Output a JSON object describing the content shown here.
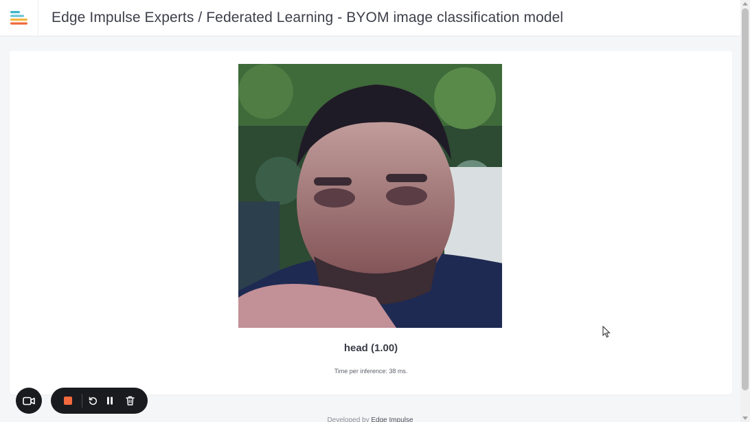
{
  "header": {
    "title": "Edge Impulse Experts / Federated Learning - BYOM image classification model",
    "logo_icon": "edge-impulse-logo-icon"
  },
  "main": {
    "classification_result": "head (1.00)",
    "inference_time": "Time per inference: 38 ms.",
    "image_description_icon": "camera-frame-image"
  },
  "footer": {
    "prefix": "Developed by ",
    "brand": "Edge Impulse"
  },
  "recorder": {
    "camera_icon": "video-camera-icon",
    "stop_icon": "stop-icon",
    "restart_icon": "restart-icon",
    "pause_icon": "pause-icon",
    "delete_icon": "trash-icon",
    "stop_color": "#f26a3d"
  },
  "colors": {
    "logo_teal": "#3bb5c8",
    "logo_yellow": "#f4b63f",
    "logo_orange": "#ef6a3a"
  }
}
